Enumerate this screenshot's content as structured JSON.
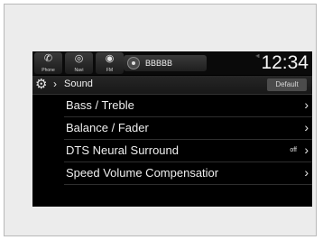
{
  "statusbar": {
    "tabs": [
      {
        "icon": "phone-icon",
        "glyph": "✆",
        "label": "Phone"
      },
      {
        "icon": "navi-icon",
        "glyph": "◎",
        "label": "Navi"
      },
      {
        "icon": "radio-icon",
        "glyph": "◉",
        "label": "FM"
      }
    ],
    "source_label": "BBBBB",
    "signal_text": "⁺ᴵ",
    "clock": "12:34"
  },
  "header": {
    "gear_glyph": "⚙",
    "arrow_glyph": "›",
    "title": "Sound",
    "default_label": "Default"
  },
  "menu": {
    "chevron": "›",
    "items": [
      {
        "label": "Bass / Treble",
        "value": ""
      },
      {
        "label": "Balance / Fader",
        "value": ""
      },
      {
        "label": "DTS Neural Surround",
        "value": "off"
      },
      {
        "label": "Speed Volume Compensatior",
        "value": ""
      }
    ]
  }
}
